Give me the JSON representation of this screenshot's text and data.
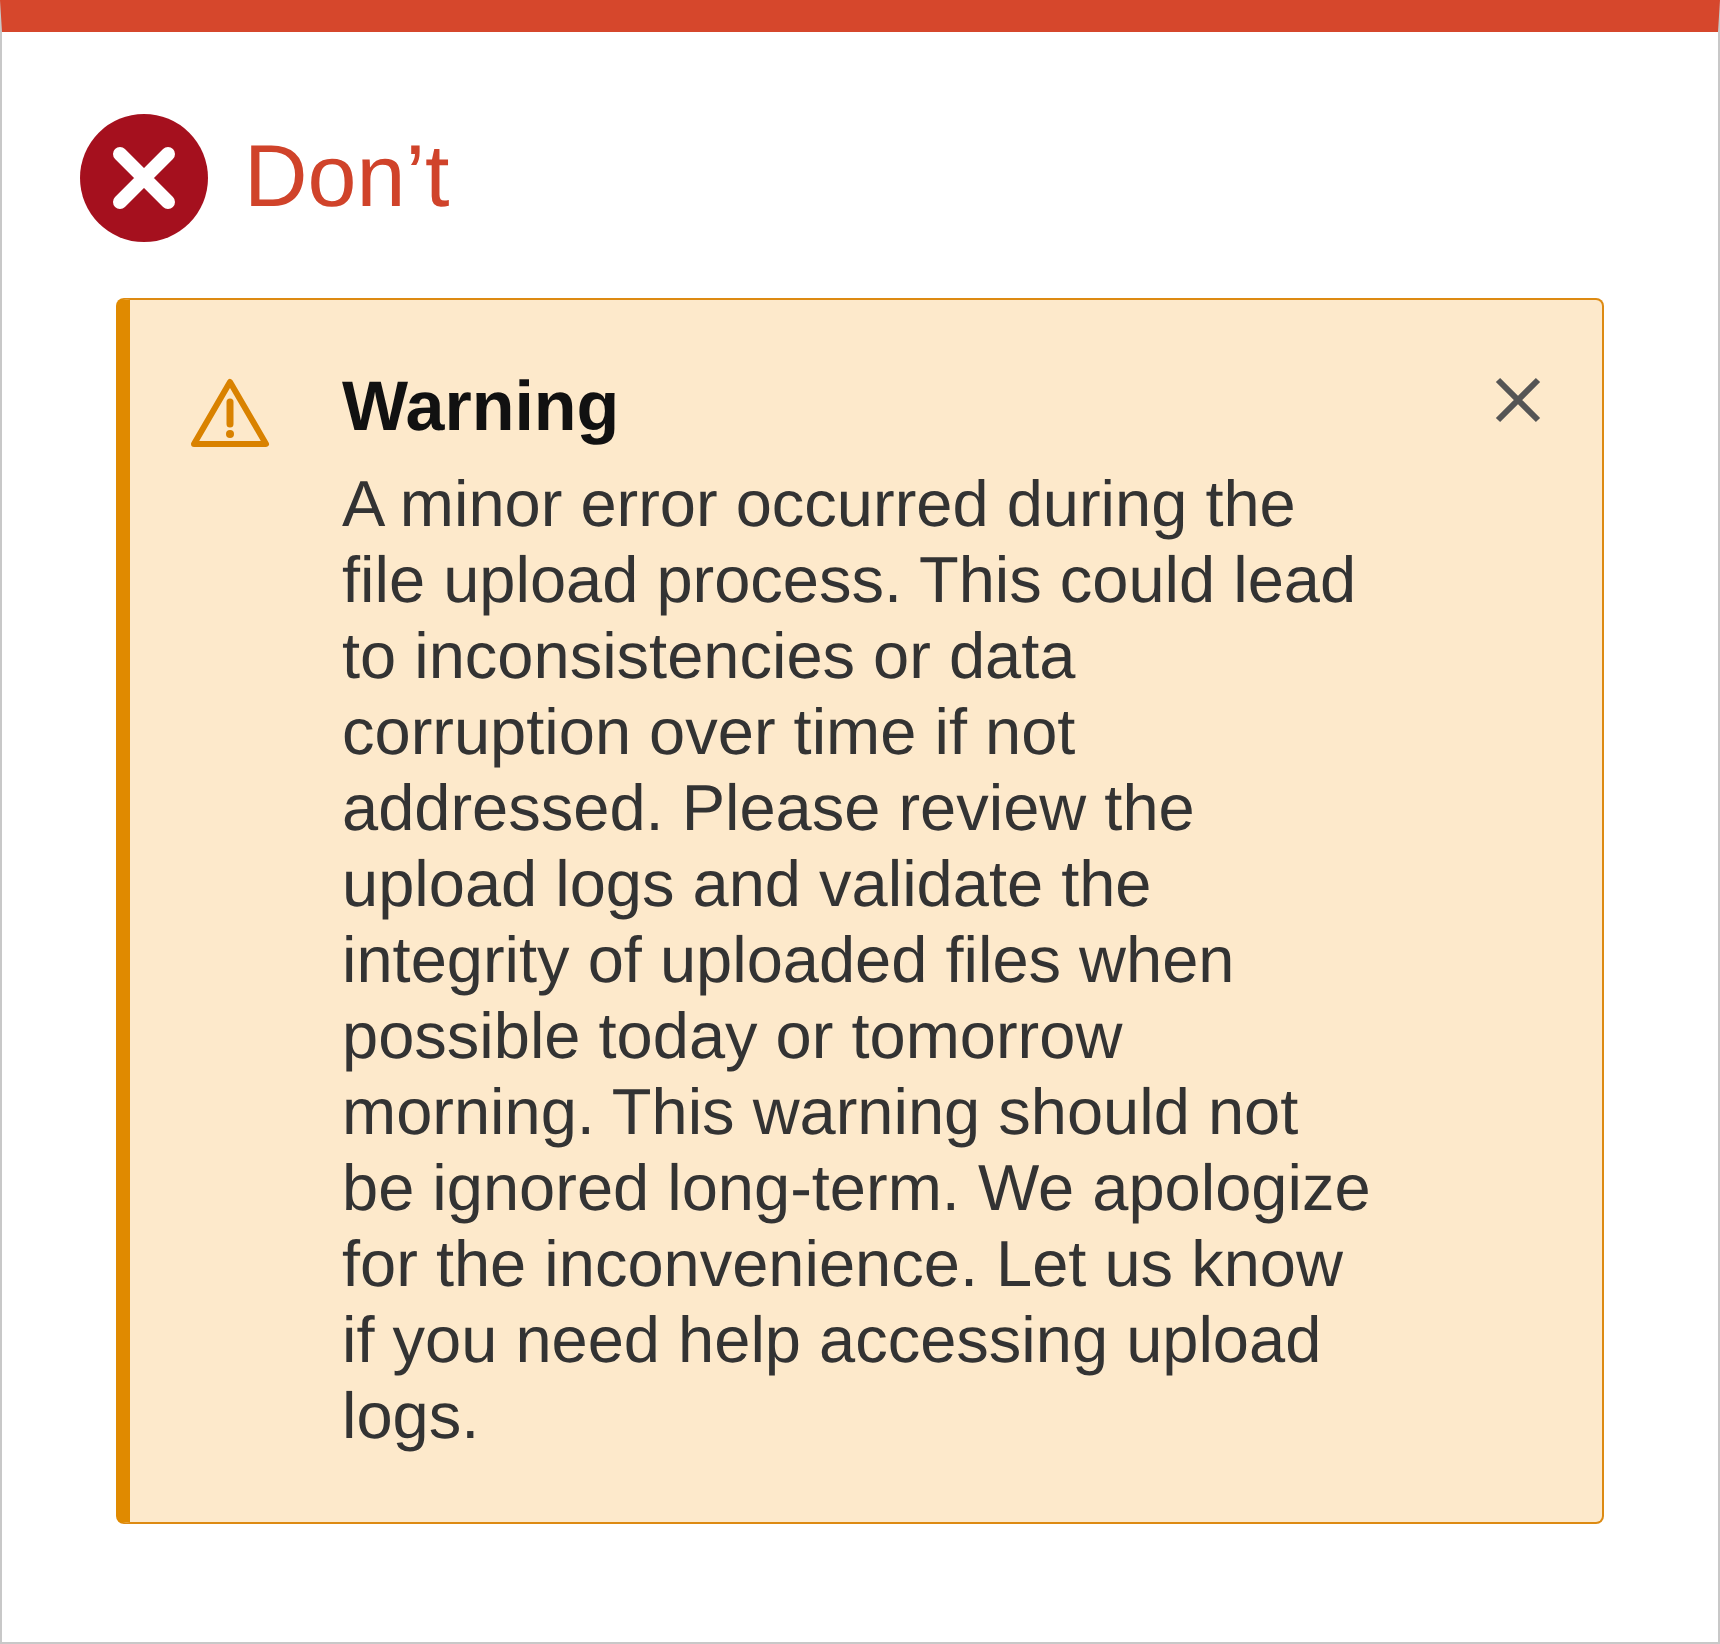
{
  "heading": {
    "kind": "dont",
    "text": "Don’t"
  },
  "alert": {
    "kind": "warning",
    "title": "Warning",
    "message": "A minor error occurred during the file upload process. This could lead to inconsistencies or data corruption over time if not addressed. Please review the upload logs and validate the integrity of uploaded files when possible today or tomorrow morning. This warning should not be ignored long-term. We apologize for the inconvenience. Let us know if you need help accessing upload logs.",
    "dismissible": true
  }
}
